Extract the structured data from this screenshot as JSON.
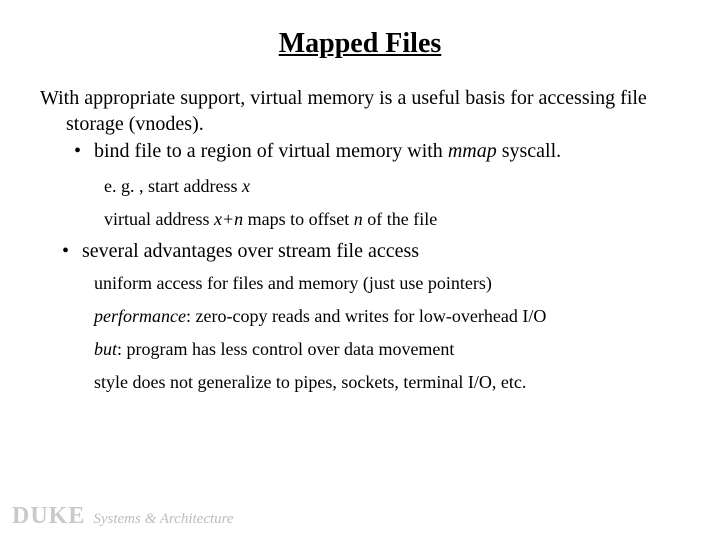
{
  "title": "Mapped Files",
  "intro_line1": "With appropriate support, virtual memory is a useful basis for",
  "intro_line2": "accessing file storage (vnodes).",
  "b1_prefix": "bind file to a region of virtual memory with ",
  "b1_mmap": "mmap",
  "b1_suffix": " syscall.",
  "sub_eg_prefix": "e. g. , start address ",
  "sub_eg_x": "x",
  "sub_va_prefix": "virtual address ",
  "sub_va_xn": "x+n",
  "sub_va_mid": "  maps to offset ",
  "sub_va_n": "n",
  "sub_va_suffix": " of the file",
  "b2": "several advantages over stream file access",
  "adv1": "uniform access for files and memory (just use pointers)",
  "adv2_perf": "performance",
  "adv2_rest": ": zero-copy reads and writes for low-overhead I/O",
  "adv3_but": "but",
  "adv3_rest": ": program has less control over data movement",
  "adv4": "style does not generalize to pipes, sockets, terminal I/O, etc.",
  "footer_duke": "DUKE",
  "footer_tagline": "Systems & Architecture"
}
